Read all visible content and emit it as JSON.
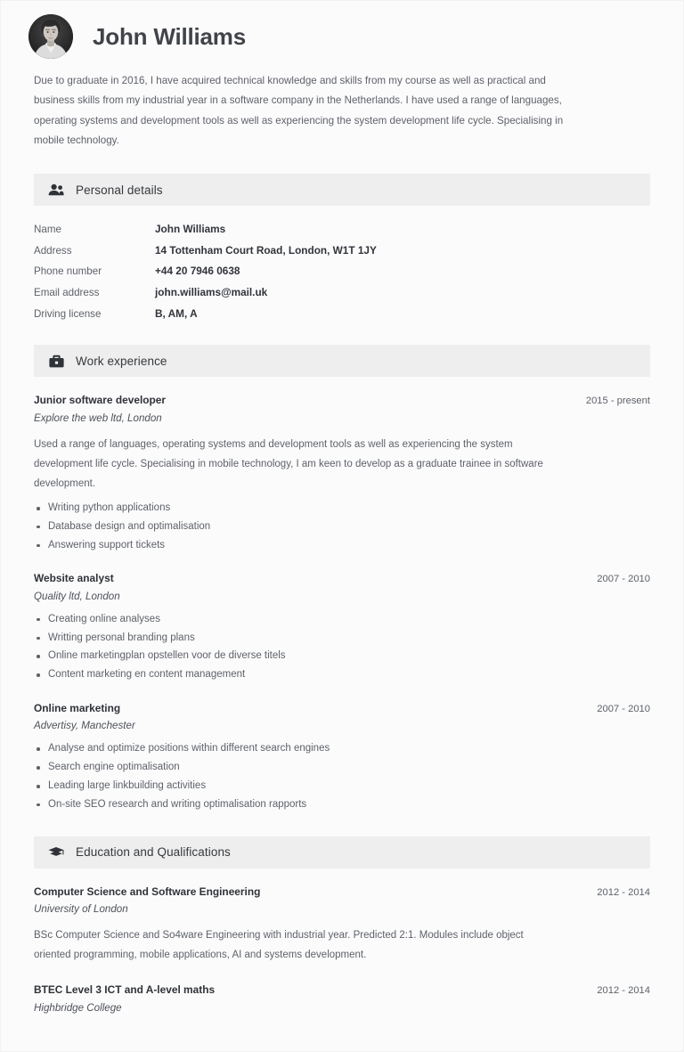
{
  "document": {
    "type": "resume",
    "background_color": "#f0f0f0",
    "page_color": "#fbfbfc",
    "section_bar_color": "#eeeeee",
    "heading_color": "#404348",
    "body_text_color": "#5e6268"
  },
  "header": {
    "full_name": "John Williams",
    "avatar_alt": "portrait-photo",
    "intro": "Due to graduate in 2016, I have acquired technical knowledge and skills from my course as well as practical and business skills from my industrial year in a software company in the Netherlands. I have used a range of languages, operating systems and development tools as well as experiencing the system development life cycle. Specialising in mobile technology."
  },
  "sections": {
    "personal_details": {
      "title": "Personal details",
      "icon": "people-icon",
      "rows": [
        {
          "label": "Name",
          "value": "John Williams"
        },
        {
          "label": "Address",
          "value": "14 Tottenham Court Road, London, W1T 1JY"
        },
        {
          "label": "Phone number",
          "value": "+44 20 7946 0638"
        },
        {
          "label": "Email address",
          "value": "john.williams@mail.uk"
        },
        {
          "label": "Driving license",
          "value": "B, AM, A"
        }
      ]
    },
    "work_experience": {
      "title": "Work experience",
      "icon": "briefcase-icon",
      "entries": [
        {
          "title": "Junior software developer",
          "date": "2015 - present",
          "subtitle": "Explore the web ltd, London",
          "description": "Used a range of languages, operating systems and development tools as well as experiencing the system development life cycle. Specialising in mobile technology, I am keen to develop as a graduate trainee in software development.",
          "bullets": [
            "Writing python applications",
            "Database design and optimalisation",
            "Answering support tickets"
          ]
        },
        {
          "title": "Website analyst",
          "date": "2007 - 2010",
          "subtitle": "Quality ltd, London",
          "description": "",
          "bullets": [
            "Creating online analyses",
            "Writting personal branding plans",
            "Online marketingplan opstellen voor de diverse titels",
            "Content marketing en content management"
          ]
        },
        {
          "title": "Online marketing",
          "date": "2007 - 2010",
          "subtitle": "Advertisy, Manchester",
          "description": "",
          "bullets": [
            "Analyse and optimize positions within different search engines",
            "Search engine optimalisation",
            "Leading large linkbuilding activities",
            "On-site SEO research and writing optimalisation rapports"
          ]
        }
      ]
    },
    "education": {
      "title": "Education and Qualifications",
      "icon": "graduation-cap-icon",
      "entries": [
        {
          "title": "Computer Science and Software Engineering",
          "date": "2012 - 2014",
          "subtitle": "University of London",
          "description": "BSc Computer Science and So4ware Engineering with industrial year. Predicted 2:1. Modules include object oriented programming, mobile applications, AI and systems development.",
          "bullets": []
        },
        {
          "title": "BTEC Level 3 ICT and A-level maths",
          "date": "2012 - 2014",
          "subtitle": "Highbridge College",
          "description": "",
          "bullets": []
        }
      ]
    }
  }
}
